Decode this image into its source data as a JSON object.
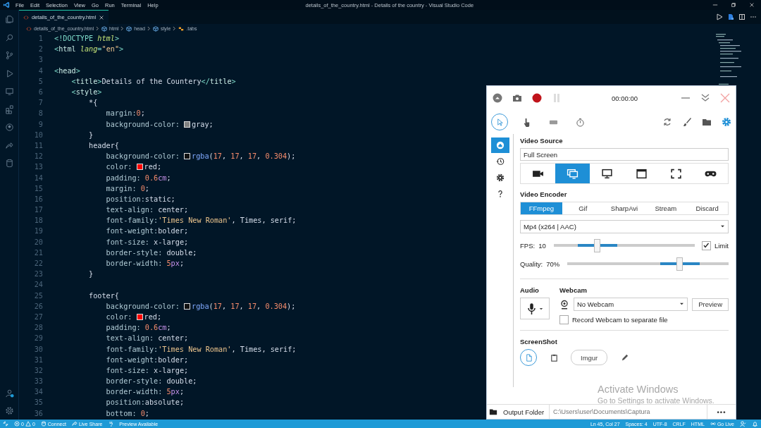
{
  "title_bar": {
    "menu": [
      "File",
      "Edit",
      "Selection",
      "View",
      "Go",
      "Run",
      "Terminal",
      "Help"
    ],
    "title": "details_of_the_country.html - Details of the country - Visual Studio Code"
  },
  "editor": {
    "tabs": [
      {
        "label": "details_of_the_country.html",
        "selected": true
      }
    ],
    "breadcrumb": [
      {
        "kind": "file",
        "label": "details_of_the_country.html"
      },
      {
        "kind": "element",
        "label": "html"
      },
      {
        "kind": "element",
        "label": "head"
      },
      {
        "kind": "element",
        "label": "style"
      },
      {
        "kind": "class",
        "label": ".tabs"
      }
    ],
    "lines": [
      {
        "n": "1",
        "tokens": [
          {
            "t": "<!DOCTYPE ",
            "kind": "p"
          },
          {
            "t": "html",
            "kind": "attr"
          },
          {
            "t": ">",
            "kind": "p"
          }
        ]
      },
      {
        "n": "2",
        "tokens": [
          {
            "t": "<",
            "kind": "p"
          },
          {
            "t": "html",
            "kind": "tag"
          },
          {
            "t": " lang",
            "kind": "attr"
          },
          {
            "t": "=",
            "kind": "p"
          },
          {
            "t": "\"en\"",
            "kind": "str"
          },
          {
            "t": ">",
            "kind": "p"
          }
        ]
      },
      {
        "n": "3"
      },
      {
        "n": "4",
        "tokens": [
          {
            "t": "<",
            "kind": "p"
          },
          {
            "t": "head",
            "kind": "tag"
          },
          {
            "t": ">",
            "kind": "p"
          }
        ]
      },
      {
        "n": "5",
        "tokens": [
          {
            "t": "    <",
            "kind": "p"
          },
          {
            "t": "title",
            "kind": "tag"
          },
          {
            "t": ">",
            "kind": "p"
          },
          {
            "t": "Details of the Countery",
            "kind": "txt"
          },
          {
            "t": "</",
            "kind": "p"
          },
          {
            "t": "title",
            "kind": "tag"
          },
          {
            "t": ">",
            "kind": "p"
          }
        ]
      },
      {
        "n": "6",
        "tokens": [
          {
            "t": "    <",
            "kind": "p"
          },
          {
            "t": "style",
            "kind": "tag"
          },
          {
            "t": ">",
            "kind": "p"
          }
        ]
      },
      {
        "n": "7",
        "tokens": [
          {
            "t": "        *{",
            "kind": "sel"
          }
        ]
      },
      {
        "n": "8",
        "tokens": [
          {
            "t": "            margin:",
            "kind": "prop"
          },
          {
            "t": "0",
            "kind": "num"
          },
          {
            "t": ";",
            "kind": "val"
          }
        ]
      },
      {
        "n": "9",
        "tokens": [
          {
            "t": "            background-color: ",
            "kind": "prop"
          },
          {
            "kind": "sw",
            "color": "#808080"
          },
          {
            "t": "gray;",
            "kind": "val"
          }
        ]
      },
      {
        "n": "10",
        "tokens": [
          {
            "t": "        }",
            "kind": "sel"
          }
        ]
      },
      {
        "n": "11",
        "tokens": [
          {
            "t": "        header{",
            "kind": "sel"
          }
        ]
      },
      {
        "n": "12",
        "tokens": [
          {
            "t": "            background-color: ",
            "kind": "prop"
          },
          {
            "kind": "sw",
            "color": "#111111"
          },
          {
            "t": "rgba",
            "kind": "fn"
          },
          {
            "t": "(",
            "kind": "val"
          },
          {
            "t": "17",
            "kind": "num"
          },
          {
            "t": ", ",
            "kind": "val"
          },
          {
            "t": "17",
            "kind": "num"
          },
          {
            "t": ", ",
            "kind": "val"
          },
          {
            "t": "17",
            "kind": "num"
          },
          {
            "t": ", ",
            "kind": "val"
          },
          {
            "t": "0.304",
            "kind": "num"
          },
          {
            "t": ");",
            "kind": "val"
          }
        ]
      },
      {
        "n": "13",
        "tokens": [
          {
            "t": "            color: ",
            "kind": "prop"
          },
          {
            "kind": "sw",
            "color": "#ff0000"
          },
          {
            "t": "red;",
            "kind": "val"
          }
        ]
      },
      {
        "n": "14",
        "tokens": [
          {
            "t": "            padding: ",
            "kind": "prop"
          },
          {
            "t": "0.6",
            "kind": "num"
          },
          {
            "t": "cm",
            "kind": "unit"
          },
          {
            "t": ";",
            "kind": "val"
          }
        ]
      },
      {
        "n": "15",
        "tokens": [
          {
            "t": "            margin: ",
            "kind": "prop"
          },
          {
            "t": "0",
            "kind": "num"
          },
          {
            "t": ";",
            "kind": "val"
          }
        ]
      },
      {
        "n": "16",
        "tokens": [
          {
            "t": "            position:",
            "kind": "prop"
          },
          {
            "t": "static;",
            "kind": "val"
          }
        ]
      },
      {
        "n": "17",
        "tokens": [
          {
            "t": "            text-align: ",
            "kind": "prop"
          },
          {
            "t": "center;",
            "kind": "val"
          }
        ]
      },
      {
        "n": "18",
        "tokens": [
          {
            "t": "            font-family:",
            "kind": "prop"
          },
          {
            "t": "'Times New Roman'",
            "kind": "str"
          },
          {
            "t": ", Times, serif;",
            "kind": "val"
          }
        ]
      },
      {
        "n": "19",
        "tokens": [
          {
            "t": "            font-weight:",
            "kind": "prop"
          },
          {
            "t": "bolder;",
            "kind": "val"
          }
        ]
      },
      {
        "n": "20",
        "tokens": [
          {
            "t": "            font-size: ",
            "kind": "prop"
          },
          {
            "t": "x-large;",
            "kind": "val"
          }
        ]
      },
      {
        "n": "21",
        "tokens": [
          {
            "t": "            border-style: ",
            "kind": "prop"
          },
          {
            "t": "double;",
            "kind": "val"
          }
        ]
      },
      {
        "n": "22",
        "tokens": [
          {
            "t": "            border-width: ",
            "kind": "prop"
          },
          {
            "t": "5",
            "kind": "num"
          },
          {
            "t": "px",
            "kind": "unit"
          },
          {
            "t": ";",
            "kind": "val"
          }
        ]
      },
      {
        "n": "23",
        "tokens": [
          {
            "t": "        }",
            "kind": "sel"
          }
        ]
      },
      {
        "n": "24"
      },
      {
        "n": "25",
        "tokens": [
          {
            "t": "        footer{",
            "kind": "sel"
          }
        ]
      },
      {
        "n": "26",
        "tokens": [
          {
            "t": "            background-color: ",
            "kind": "prop"
          },
          {
            "kind": "sw",
            "color": "#111111"
          },
          {
            "t": "rgba",
            "kind": "fn"
          },
          {
            "t": "(",
            "kind": "val"
          },
          {
            "t": "17",
            "kind": "num"
          },
          {
            "t": ", ",
            "kind": "val"
          },
          {
            "t": "17",
            "kind": "num"
          },
          {
            "t": ", ",
            "kind": "val"
          },
          {
            "t": "17",
            "kind": "num"
          },
          {
            "t": ", ",
            "kind": "val"
          },
          {
            "t": "0.304",
            "kind": "num"
          },
          {
            "t": ");",
            "kind": "val"
          }
        ]
      },
      {
        "n": "27",
        "tokens": [
          {
            "t": "            color: ",
            "kind": "prop"
          },
          {
            "kind": "sw",
            "color": "#ff0000"
          },
          {
            "t": "red;",
            "kind": "val"
          }
        ]
      },
      {
        "n": "28",
        "tokens": [
          {
            "t": "            padding: ",
            "kind": "prop"
          },
          {
            "t": "0.6",
            "kind": "num"
          },
          {
            "t": "cm",
            "kind": "unit"
          },
          {
            "t": ";",
            "kind": "val"
          }
        ]
      },
      {
        "n": "29",
        "tokens": [
          {
            "t": "            text-align: ",
            "kind": "prop"
          },
          {
            "t": "center;",
            "kind": "val"
          }
        ]
      },
      {
        "n": "30",
        "tokens": [
          {
            "t": "            font-family:",
            "kind": "prop"
          },
          {
            "t": "'Times New Roman'",
            "kind": "str"
          },
          {
            "t": ", Times, serif;",
            "kind": "val"
          }
        ]
      },
      {
        "n": "31",
        "tokens": [
          {
            "t": "            font-weight:",
            "kind": "prop"
          },
          {
            "t": "bolder;",
            "kind": "val"
          }
        ]
      },
      {
        "n": "32",
        "tokens": [
          {
            "t": "            font-size: ",
            "kind": "prop"
          },
          {
            "t": "x-large;",
            "kind": "val"
          }
        ]
      },
      {
        "n": "33",
        "tokens": [
          {
            "t": "            border-style: ",
            "kind": "prop"
          },
          {
            "t": "double;",
            "kind": "val"
          }
        ]
      },
      {
        "n": "34",
        "tokens": [
          {
            "t": "            border-width: ",
            "kind": "prop"
          },
          {
            "t": "5",
            "kind": "num"
          },
          {
            "t": "px",
            "kind": "unit"
          },
          {
            "t": ";",
            "kind": "val"
          }
        ]
      },
      {
        "n": "35",
        "tokens": [
          {
            "t": "            position:",
            "kind": "prop"
          },
          {
            "t": "absolute;",
            "kind": "val"
          }
        ]
      },
      {
        "n": "36",
        "tokens": [
          {
            "t": "            bottom: ",
            "kind": "prop"
          },
          {
            "t": "0",
            "kind": "num"
          },
          {
            "t": ";",
            "kind": "val"
          }
        ]
      }
    ]
  },
  "recorder": {
    "time": "00:00:00",
    "tools": [
      {
        "kind": "cursor",
        "selected": true
      },
      {
        "kind": "clicks",
        "selected": false
      },
      {
        "kind": "keys",
        "selected": false
      },
      {
        "kind": "timer",
        "selected": false
      }
    ],
    "nav": [
      {
        "kind": "home",
        "selected": true
      },
      {
        "kind": "history",
        "selected": false
      },
      {
        "kind": "settings",
        "selected": false
      },
      {
        "kind": "help",
        "selected": false
      }
    ],
    "video_source": {
      "heading": "Video Source",
      "value": "Full Screen",
      "sources": [
        {
          "kind": "webcam",
          "selected": false
        },
        {
          "kind": "screens",
          "selected": true
        },
        {
          "kind": "screen",
          "selected": false
        },
        {
          "kind": "window",
          "selected": false
        },
        {
          "kind": "region",
          "selected": false
        },
        {
          "kind": "gamepad",
          "selected": false
        }
      ]
    },
    "video_encoder": {
      "heading": "Video Encoder",
      "tabs": [
        {
          "label": "FFmpeg",
          "selected": true
        },
        {
          "label": "Gif",
          "selected": false
        },
        {
          "label": "SharpAvi",
          "selected": false
        },
        {
          "label": "Stream",
          "selected": false
        },
        {
          "label": "Discard",
          "selected": false
        }
      ],
      "format": "Mp4 (x264 | AAC)"
    },
    "fps": {
      "label": "FPS:",
      "reading": "10",
      "level": 0.31,
      "limit": {
        "label": "Limit",
        "checked": true
      }
    },
    "quality": {
      "label": "Quality:",
      "reading": "70%",
      "level": 0.7
    },
    "audio": {
      "heading": "Audio"
    },
    "webcam": {
      "heading": "Webcam",
      "value": "No Webcam",
      "preview": "Preview",
      "separate": {
        "label": "Record Webcam to separate file",
        "checked": false
      }
    },
    "screenshot": {
      "heading": "ScreenShot",
      "targets": [
        {
          "kind": "disk",
          "selected": true
        },
        {
          "kind": "clipboard",
          "selected": false
        },
        {
          "kind": "imgur",
          "label": "Imgur",
          "selected": false
        },
        {
          "kind": "editor",
          "selected": false
        }
      ]
    },
    "output": {
      "label": "Output Folder",
      "path": "C:\\Users\\user\\Documents\\Captura",
      "more": "•••"
    }
  },
  "activation": {
    "title": "Activate Windows",
    "hint": "Go to Settings to activate Windows."
  },
  "status_bar": {
    "left": [
      {
        "kind": "remote"
      },
      {
        "kind": "problems",
        "errors": "0",
        "warnings": "0"
      },
      {
        "kind": "connect",
        "label": "Connect"
      },
      {
        "kind": "liveshare",
        "label": "Live Share"
      },
      {
        "kind": "plug"
      },
      {
        "kind": "text",
        "label": "Preview Available"
      }
    ],
    "right": [
      {
        "kind": "text",
        "label": "Ln 45, Col 27"
      },
      {
        "kind": "text",
        "label": "Spaces: 4"
      },
      {
        "kind": "text",
        "label": "UTF-8"
      },
      {
        "kind": "text",
        "label": "CRLF"
      },
      {
        "kind": "text",
        "label": "HTML"
      },
      {
        "kind": "golive",
        "label": "Go Live"
      },
      {
        "kind": "feedback"
      },
      {
        "kind": "bell"
      }
    ]
  }
}
